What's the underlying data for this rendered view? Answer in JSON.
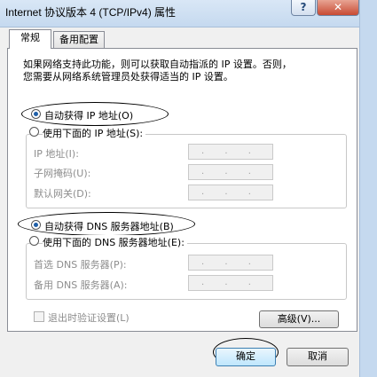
{
  "window": {
    "title": "Internet 协议版本 4 (TCP/IPv4) 属性",
    "help": "?",
    "close": "✕"
  },
  "tabs": [
    {
      "label": "常规"
    },
    {
      "label": "备用配置"
    }
  ],
  "description": {
    "line1": "如果网络支持此功能，则可以获取自动指派的 IP 设置。否则，",
    "line2": "您需要从网络系统管理员处获得适当的 IP 设置。"
  },
  "ip": {
    "auto_label": "自动获得 IP 地址(O)",
    "manual_label": "使用下面的 IP 地址(S):",
    "fields": [
      {
        "label": "IP 地址(I):",
        "value": ". . ."
      },
      {
        "label": "子网掩码(U):",
        "value": ". . ."
      },
      {
        "label": "默认网关(D):",
        "value": ". . ."
      }
    ],
    "selected": "auto"
  },
  "dns": {
    "auto_label": "自动获得 DNS 服务器地址(B)",
    "manual_label": "使用下面的 DNS 服务器地址(E):",
    "fields": [
      {
        "label": "首选 DNS 服务器(P):",
        "value": ". . ."
      },
      {
        "label": "备用 DNS 服务器(A):",
        "value": ". . ."
      }
    ],
    "selected": "auto"
  },
  "validate_on_exit": {
    "label": "退出时验证设置(L)",
    "checked": false
  },
  "buttons": {
    "advanced": "高级(V)...",
    "ok": "确定",
    "cancel": "取消"
  }
}
